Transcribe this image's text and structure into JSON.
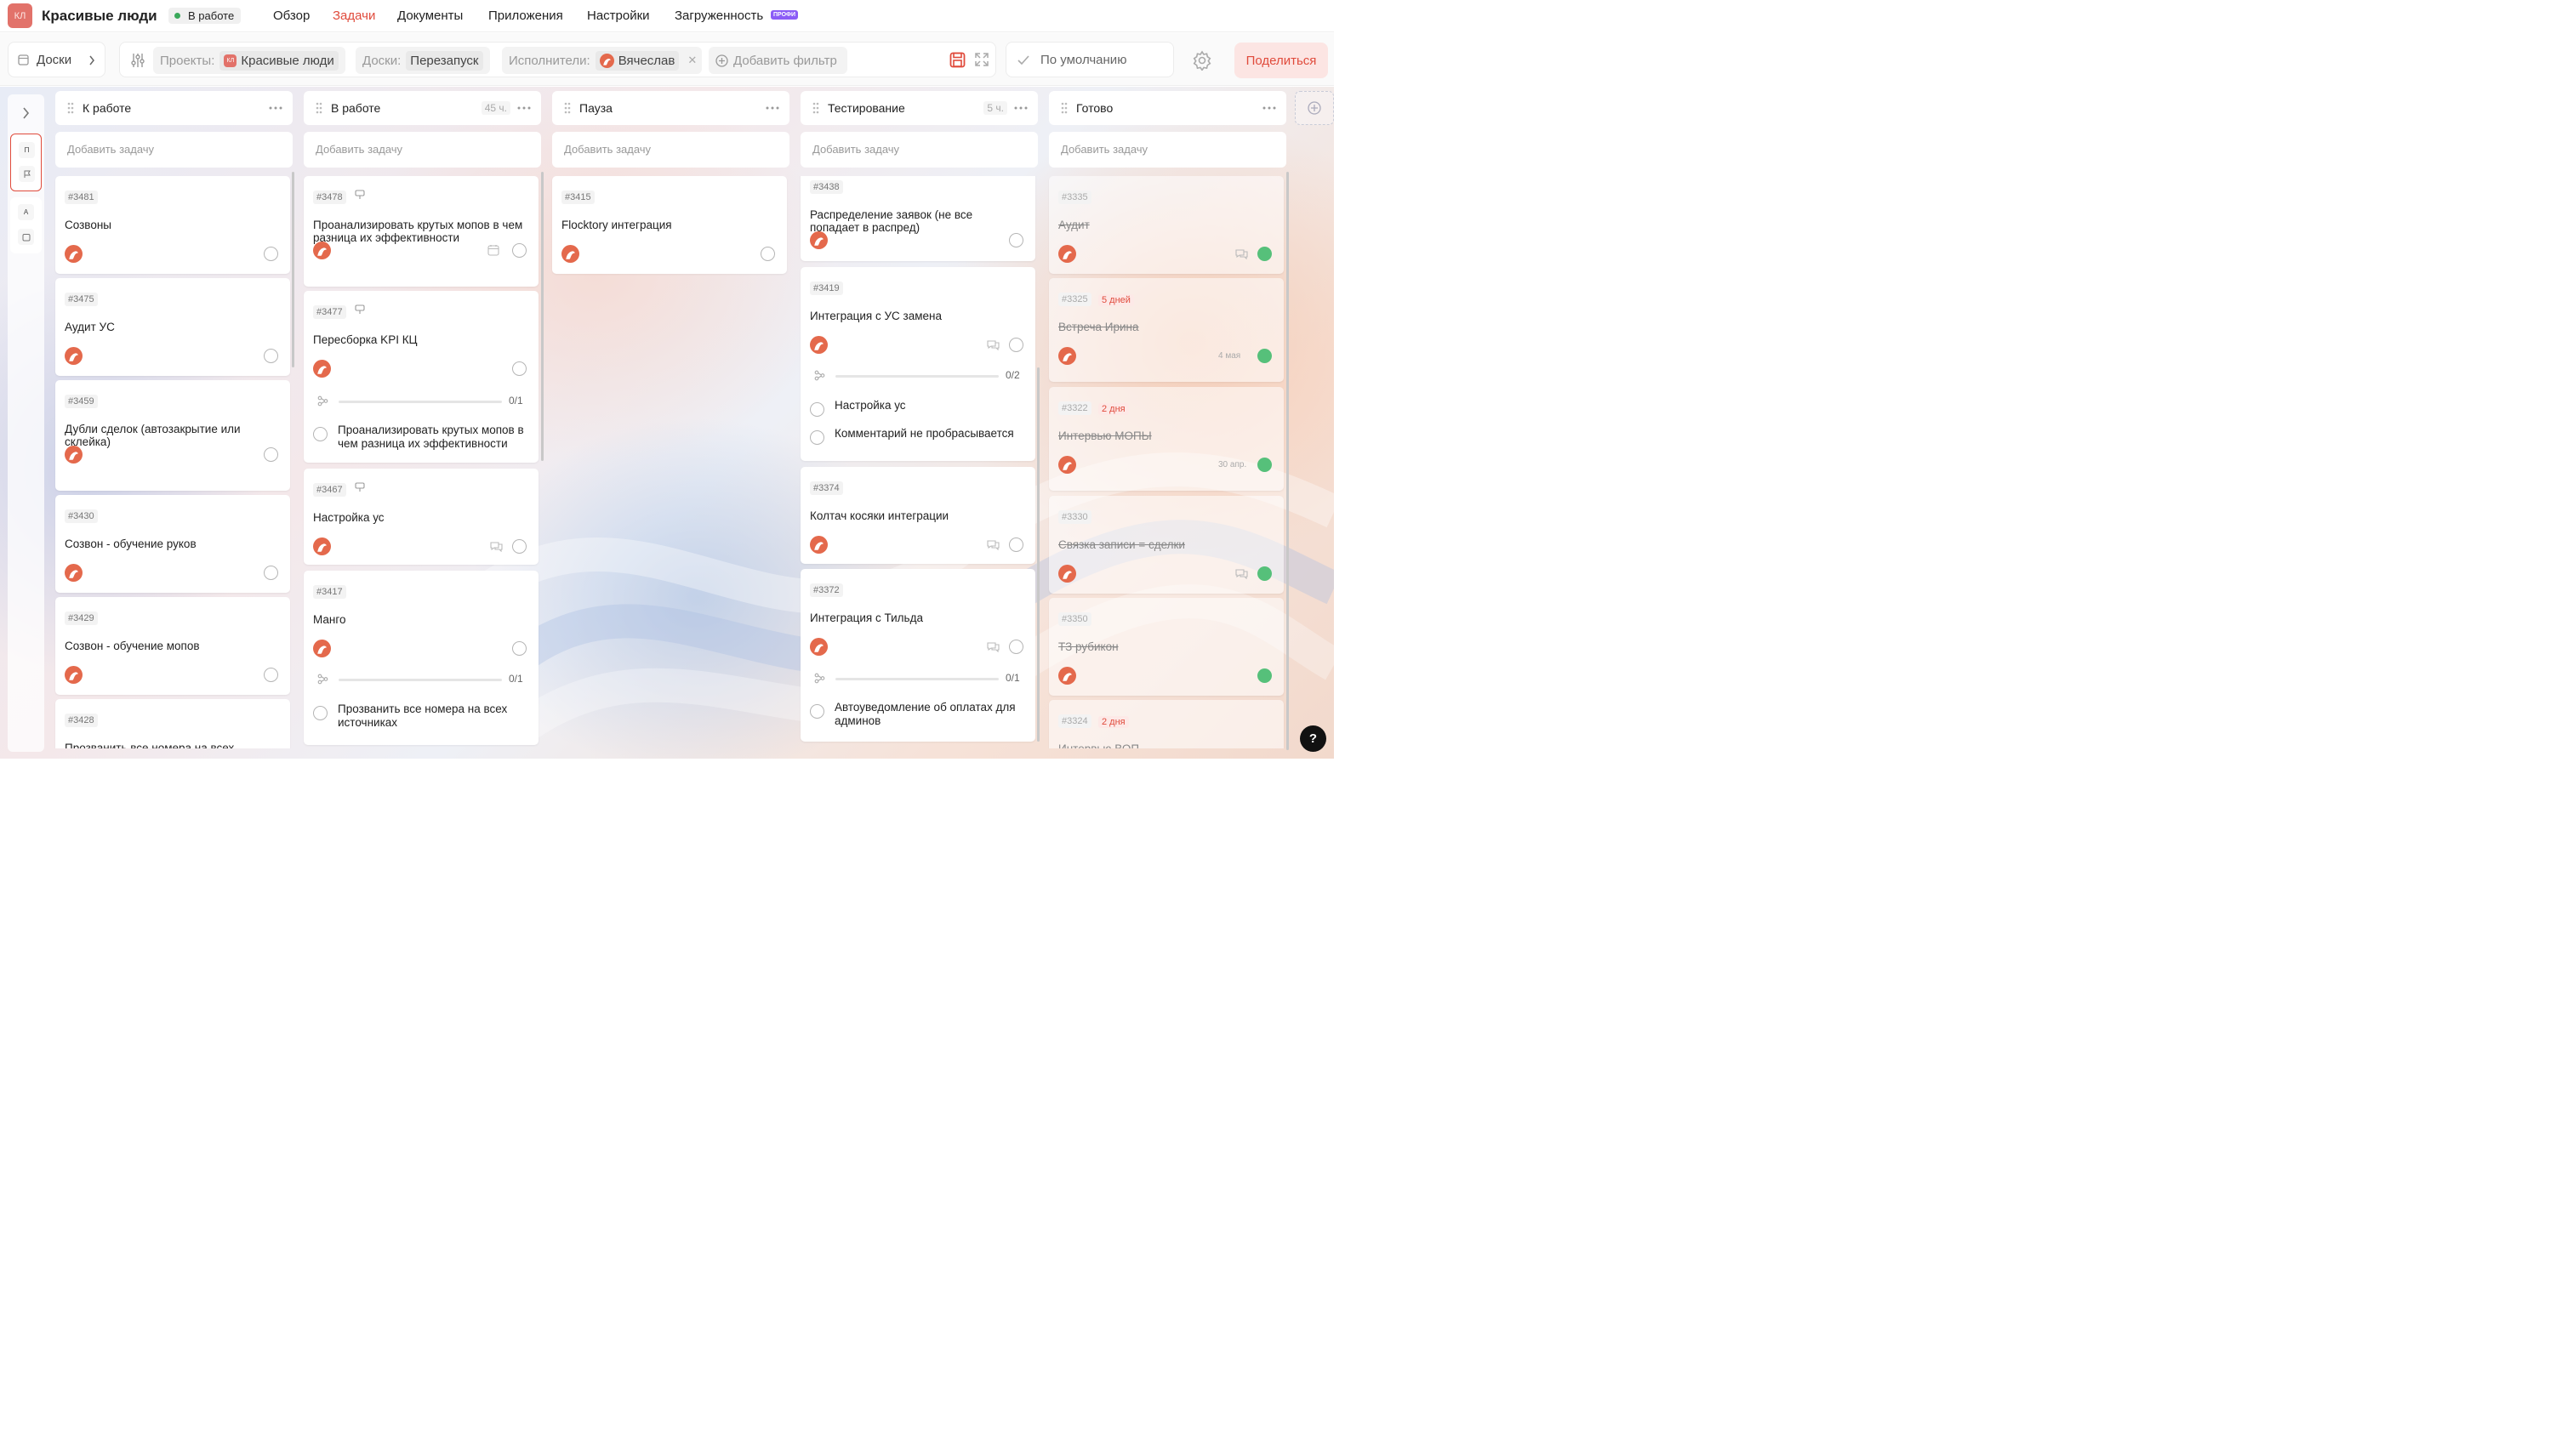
{
  "header": {
    "logo": "КЛ",
    "project_title": "Красивые люди",
    "status": "В работе",
    "nav": [
      "Обзор",
      "Задачи",
      "Документы",
      "Приложения",
      "Настройки",
      "Загруженность"
    ],
    "pro_badge": "ПРОФИ"
  },
  "filters": {
    "boards_label": "Доски",
    "projects_label": "Проекты:",
    "projects_value": "Красивые люди",
    "boards_filter_label": "Доски:",
    "boards_value": "Перезапуск",
    "assignees_label": "Исполнители:",
    "assignees_value": "Вячеслав",
    "add_filter": "Добавить фильтр",
    "preset": "По умолчанию",
    "share": "Поделиться"
  },
  "sidebar": {
    "group1": [
      "П"
    ],
    "group2": [
      "А"
    ]
  },
  "add_task_placeholder": "Добавить задачу",
  "columns": [
    {
      "name": "К работе",
      "hours": "",
      "cards": [
        {
          "id": "#3481",
          "title": "Созвоны"
        },
        {
          "id": "#3475",
          "title": "Аудит УС"
        },
        {
          "id": "#3459",
          "title": "Дубли сделок (автозакрытие или склейка)"
        },
        {
          "id": "#3430",
          "title": "Созвон - обучение руков"
        },
        {
          "id": "#3429",
          "title": "Созвон - обучение мопов"
        },
        {
          "id": "#3428",
          "title": "Прозванить все номера на всех"
        }
      ]
    },
    {
      "name": "В работе",
      "hours": "45 ч.",
      "cards": [
        {
          "id": "#3478",
          "title": "Проанализировать крутых мопов в чем разница их эффективности"
        },
        {
          "id": "#3477",
          "title": "Пересборка KPI КЦ",
          "progress": "0/1",
          "subtasks": [
            "Проанализировать крутых мопов в чем разница их эффективности"
          ]
        },
        {
          "id": "#3467",
          "title": "Настройка ус"
        },
        {
          "id": "#3417",
          "title": "Манго",
          "progress": "0/1",
          "subtasks": [
            "Прозванить все номера на всех источниках"
          ]
        }
      ]
    },
    {
      "name": "Пауза",
      "hours": "",
      "cards": [
        {
          "id": "#3415",
          "title": "Flocktory интеграция"
        }
      ]
    },
    {
      "name": "Тестирование",
      "hours": "5 ч.",
      "cards": [
        {
          "id": "#3438",
          "title": "Распределение заявок (не все попадает в распред)"
        },
        {
          "id": "#3419",
          "title": "Интеграция с УС замена",
          "progress": "0/2",
          "subtasks": [
            "Настройка ус",
            "Комментарий не пробрасывается"
          ]
        },
        {
          "id": "#3374",
          "title": "Колтач косяки интеграции"
        },
        {
          "id": "#3372",
          "title": "Интеграция с Тильда",
          "progress": "0/1",
          "subtasks": [
            "Автоуведомление об оплатах для админов"
          ]
        }
      ]
    },
    {
      "name": "Готово",
      "hours": "",
      "cards": [
        {
          "id": "#3335",
          "title": "Аудит"
        },
        {
          "id": "#3325",
          "due": "5 дней",
          "title": "Встреча Ирина",
          "date": "4 мая"
        },
        {
          "id": "#3322",
          "due": "2 дня",
          "title": "Интервью МОПЫ",
          "date": "30 апр."
        },
        {
          "id": "#3330",
          "title": "Связка записи = сделки"
        },
        {
          "id": "#3350",
          "title": "ТЗ рубикон"
        },
        {
          "id": "#3324",
          "due": "2 дня",
          "title": "Интервью ВОП"
        }
      ]
    }
  ],
  "help": "?"
}
